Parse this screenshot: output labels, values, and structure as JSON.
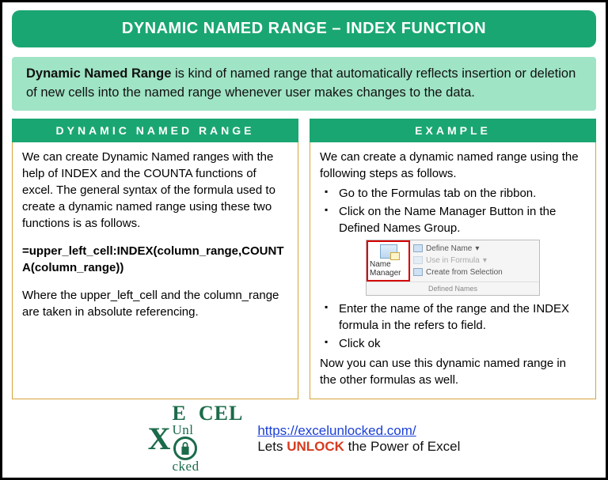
{
  "title": "DYNAMIC NAMED RANGE – INDEX FUNCTION",
  "intro": {
    "bold": "Dynamic Named Range",
    "rest": " is kind of named range that automatically reflects insertion or deletion of new cells into the named range whenever user makes changes to the data."
  },
  "left": {
    "header": "DYNAMIC NAMED RANGE",
    "para1": "We can create Dynamic Named ranges with the help of INDEX and the COUNTA functions of excel. The general syntax of the formula used to create a dynamic named range using these two functions is as follows.",
    "formula": "=upper_left_cell:INDEX(column_range,COUNTA(column_range))",
    "para2": "Where the upper_left_cell and the column_range are taken in absolute referencing."
  },
  "right": {
    "header": "EXAMPLE",
    "intro": "We can create a dynamic named range using the following steps as follows.",
    "steps": [
      "Go to the Formulas tab on the ribbon.",
      "Click on the Name Manager Button in the Defined Names Group."
    ],
    "ribbon": {
      "name_manager": "Name Manager",
      "define_name": "Define Name",
      "use_in_formula": "Use in Formula",
      "create_from_sel": "Create from Selection",
      "group_label": "Defined Names"
    },
    "steps2": [
      "Enter the name of the range and the INDEX formula in the refers to field.",
      "Click ok"
    ],
    "outro": "Now you can use this dynamic named range in the other formulas as well."
  },
  "footer": {
    "logo_top": "E   CEL",
    "logo_bot": "Unl  cked",
    "url": "https://excelunlocked.com/",
    "tagline_pre": "Lets ",
    "tagline_unlock": "UNLOCK",
    "tagline_post": " the Power of Excel"
  }
}
